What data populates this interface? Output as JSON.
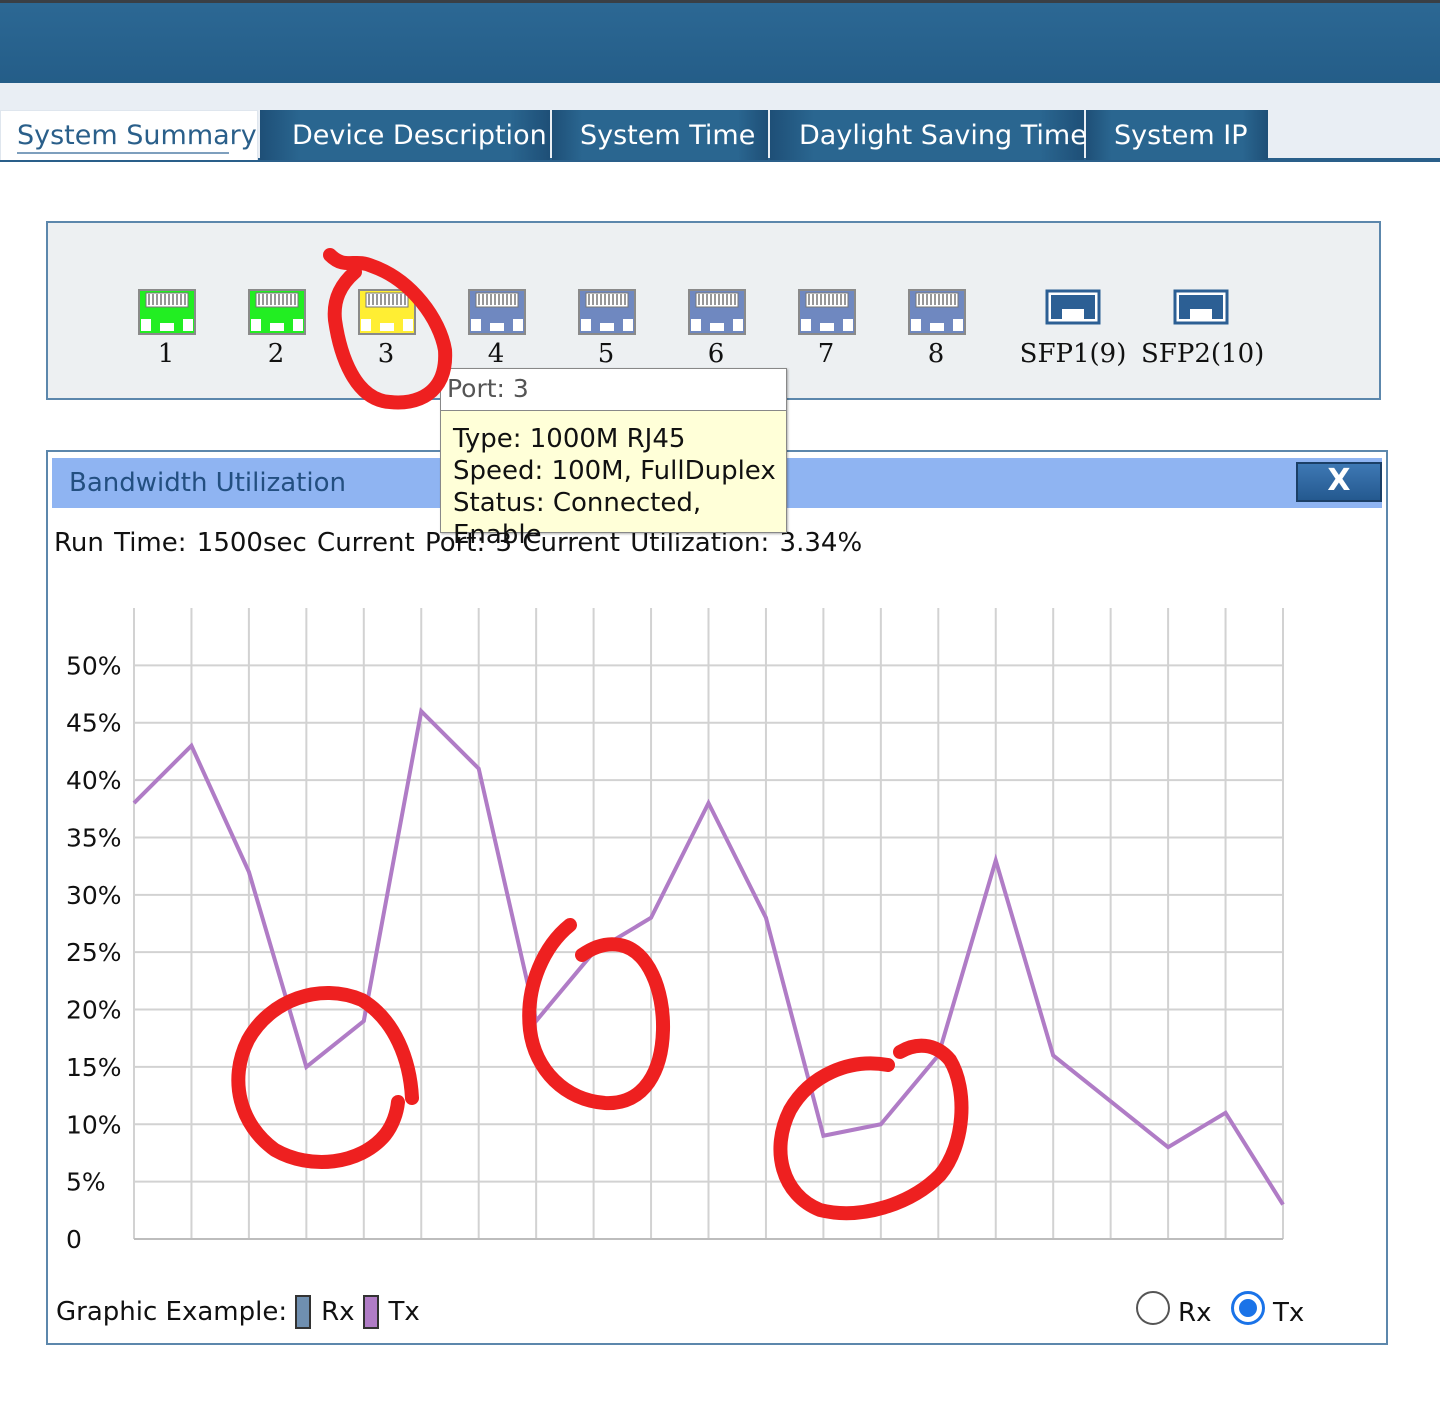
{
  "tabs": [
    {
      "label": "System Summary",
      "active": true
    },
    {
      "label": "Device Description",
      "active": false
    },
    {
      "label": "System Time",
      "active": false
    },
    {
      "label": "Daylight Saving Time",
      "active": false
    },
    {
      "label": "System IP",
      "active": false
    }
  ],
  "ports": [
    {
      "label": "1",
      "kind": "rj45",
      "status": "connected",
      "color": "#22ee22"
    },
    {
      "label": "2",
      "kind": "rj45",
      "status": "connected",
      "color": "#22ee22"
    },
    {
      "label": "3",
      "kind": "rj45",
      "status": "selected",
      "color": "#ffee33"
    },
    {
      "label": "4",
      "kind": "rj45",
      "status": "disconnected",
      "color": "#6f88c0"
    },
    {
      "label": "5",
      "kind": "rj45",
      "status": "disconnected",
      "color": "#6f88c0"
    },
    {
      "label": "6",
      "kind": "rj45",
      "status": "disconnected",
      "color": "#6f88c0"
    },
    {
      "label": "7",
      "kind": "rj45",
      "status": "disconnected",
      "color": "#6f88c0"
    },
    {
      "label": "8",
      "kind": "rj45",
      "status": "disconnected",
      "color": "#6f88c0"
    },
    {
      "label": "SFP1(9)",
      "kind": "sfp",
      "status": "disconnected",
      "color": "#2c5f94"
    },
    {
      "label": "SFP2(10)",
      "kind": "sfp",
      "status": "disconnected",
      "color": "#2c5f94"
    }
  ],
  "tooltip": {
    "title": "Port: 3",
    "type": "Type: 1000M RJ45",
    "speed": "Speed: 100M, FullDuplex",
    "status": "Status: Connected, Enable"
  },
  "bandwidth": {
    "title": "Bandwidth Utilization",
    "close_label": "X",
    "run_time": "Run Time: 1500sec Current Port: 3 Current Utilization: 3.34%",
    "legend_label": "Graphic Example:",
    "rx_label": "Rx",
    "tx_label": "Tx",
    "rx_color": "#6f8fb0",
    "tx_color": "#b07cc6",
    "selected_series": "Tx"
  },
  "chart_data": {
    "type": "line",
    "x": [
      0,
      1,
      2,
      3,
      4,
      5,
      6,
      7,
      8,
      9,
      10,
      11,
      12,
      13,
      14,
      15,
      16,
      17,
      18,
      19,
      20
    ],
    "series": [
      {
        "name": "Tx",
        "values": [
          38,
          43,
          32,
          15,
          19,
          46,
          41,
          19,
          25,
          28,
          38,
          28,
          9,
          10,
          16,
          33,
          16,
          12,
          8,
          11,
          3
        ]
      }
    ],
    "ylim": [
      0,
      55
    ],
    "ytick_values": [
      0,
      5,
      10,
      15,
      20,
      25,
      30,
      35,
      40,
      45,
      50
    ],
    "yticks": [
      "0",
      "5%",
      "10%",
      "15%",
      "20%",
      "25%",
      "30%",
      "35%",
      "40%",
      "45%",
      "50%"
    ],
    "grid": true
  }
}
